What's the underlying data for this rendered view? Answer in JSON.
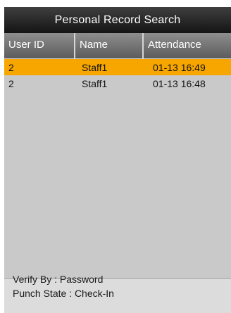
{
  "title": "Personal Record Search",
  "columns": {
    "user_id": "User ID",
    "name": "Name",
    "attendance": "Attendance"
  },
  "records": [
    {
      "user_id": "2",
      "name": "Staff1",
      "attendance": "01-13 16:49",
      "selected": true
    },
    {
      "user_id": "2",
      "name": "Staff1",
      "attendance": "01-13 16:48",
      "selected": false
    }
  ],
  "footer": {
    "verify_by": "Verify By : Password",
    "punch_state": "Punch State : Check-In"
  },
  "colors": {
    "selected_row": "#f7a600",
    "title_bar": "#1e1e1e",
    "header_bar": "#7a7a7a",
    "background": "#c9c9c9"
  }
}
